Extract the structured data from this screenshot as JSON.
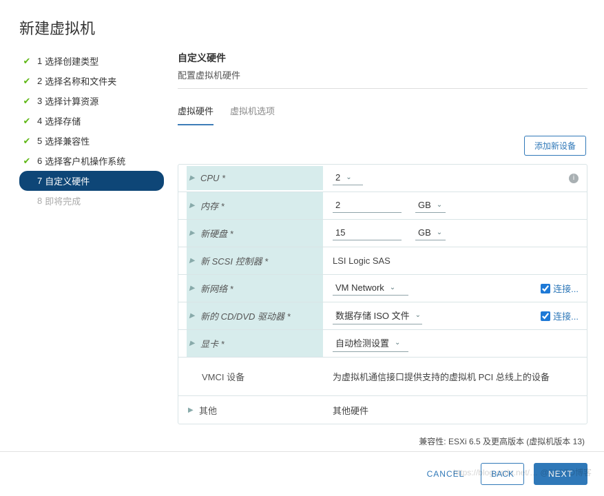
{
  "title": "新建虚拟机",
  "steps": [
    {
      "num": "1",
      "label": "选择创建类型",
      "state": "done"
    },
    {
      "num": "2",
      "label": "选择名称和文件夹",
      "state": "done"
    },
    {
      "num": "3",
      "label": "选择计算资源",
      "state": "done"
    },
    {
      "num": "4",
      "label": "选择存储",
      "state": "done"
    },
    {
      "num": "5",
      "label": "选择兼容性",
      "state": "done"
    },
    {
      "num": "6",
      "label": "选择客户机操作系统",
      "state": "done"
    },
    {
      "num": "7",
      "label": "自定义硬件",
      "state": "active"
    },
    {
      "num": "8",
      "label": "即将完成",
      "state": "pending"
    }
  ],
  "section": {
    "title": "自定义硬件",
    "subtitle": "配置虚拟机硬件"
  },
  "tabs": [
    {
      "label": "虚拟硬件",
      "active": true
    },
    {
      "label": "虚拟机选项",
      "active": false
    }
  ],
  "add_device_label": "添加新设备",
  "hardware": {
    "cpu": {
      "label": "CPU *",
      "value": "2"
    },
    "memory": {
      "label": "内存 *",
      "value": "2",
      "unit": "GB"
    },
    "disk": {
      "label": "新硬盘 *",
      "value": "15",
      "unit": "GB"
    },
    "scsi": {
      "label": "新 SCSI 控制器 *",
      "value": "LSI Logic SAS"
    },
    "net": {
      "label": "新网络 *",
      "value": "VM Network",
      "connect_label": "连接...",
      "connect_checked": true
    },
    "cd": {
      "label": "新的 CD/DVD 驱动器 *",
      "value": "数据存储 ISO 文件",
      "connect_label": "连接...",
      "connect_checked": true
    },
    "gpu": {
      "label": "显卡 *",
      "value": "自动检测设置"
    },
    "vmci": {
      "label": "VMCI 设备",
      "value": "为虚拟机通信接口提供支持的虚拟机 PCI 总线上的设备"
    },
    "other": {
      "label": "其他",
      "value": "其他硬件"
    }
  },
  "compat": "兼容性: ESXi 6.5 及更高版本 (虚拟机版本 13)",
  "footer": {
    "cancel": "CANCEL",
    "back": "BACK",
    "next": "NEXT"
  },
  "watermark": "https://blog.csdn.net/… @51CTO博客"
}
